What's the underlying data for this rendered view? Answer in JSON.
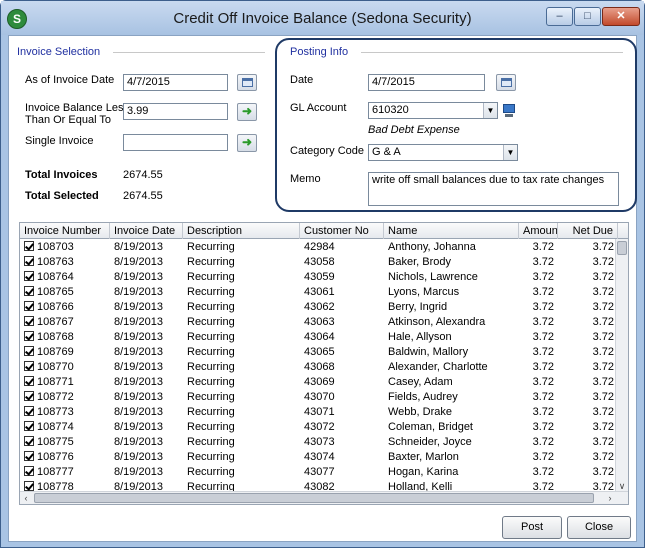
{
  "window": {
    "title": "Credit Off Invoice Balance (Sedona Security)",
    "icon_letter": "S"
  },
  "invoice_selection": {
    "section_title": "Invoice Selection",
    "as_of_label": "As of Invoice Date",
    "as_of_value": "4/7/2015",
    "balance_label_line1": "Invoice Balance Less",
    "balance_label_line2": "Than Or Equal To",
    "balance_value": "3.99",
    "single_invoice_label": "Single Invoice",
    "single_invoice_value": "",
    "total_invoices_label": "Total Invoices",
    "total_invoices_value": "2674.55",
    "total_selected_label": "Total Selected",
    "total_selected_value": "2674.55"
  },
  "posting_info": {
    "section_title": "Posting Info",
    "date_label": "Date",
    "date_value": "4/7/2015",
    "gl_label": "GL Account",
    "gl_value": "610320",
    "gl_description": "Bad Debt Expense",
    "category_label": "Category Code",
    "category_value": "G & A",
    "memo_label": "Memo",
    "memo_value": "write off small balances due to tax rate changes"
  },
  "grid": {
    "columns": [
      "Invoice Number",
      "Invoice Date",
      "Description",
      "Customer No",
      "Name",
      "Amount",
      "Net Due"
    ],
    "rows": [
      [
        "108703",
        "8/19/2013",
        "Recurring",
        "42984",
        "Anthony, Johanna",
        "3.72",
        "3.72"
      ],
      [
        "108763",
        "8/19/2013",
        "Recurring",
        "43058",
        "Baker, Brody",
        "3.72",
        "3.72"
      ],
      [
        "108764",
        "8/19/2013",
        "Recurring",
        "43059",
        "Nichols, Lawrence",
        "3.72",
        "3.72"
      ],
      [
        "108765",
        "8/19/2013",
        "Recurring",
        "43061",
        "Lyons, Marcus",
        "3.72",
        "3.72"
      ],
      [
        "108766",
        "8/19/2013",
        "Recurring",
        "43062",
        "Berry, Ingrid",
        "3.72",
        "3.72"
      ],
      [
        "108767",
        "8/19/2013",
        "Recurring",
        "43063",
        "Atkinson, Alexandra",
        "3.72",
        "3.72"
      ],
      [
        "108768",
        "8/19/2013",
        "Recurring",
        "43064",
        "Hale, Allyson",
        "3.72",
        "3.72"
      ],
      [
        "108769",
        "8/19/2013",
        "Recurring",
        "43065",
        "Baldwin, Mallory",
        "3.72",
        "3.72"
      ],
      [
        "108770",
        "8/19/2013",
        "Recurring",
        "43068",
        "Alexander, Charlotte",
        "3.72",
        "3.72"
      ],
      [
        "108771",
        "8/19/2013",
        "Recurring",
        "43069",
        "Casey, Adam",
        "3.72",
        "3.72"
      ],
      [
        "108772",
        "8/19/2013",
        "Recurring",
        "43070",
        "Fields, Audrey",
        "3.72",
        "3.72"
      ],
      [
        "108773",
        "8/19/2013",
        "Recurring",
        "43071",
        "Webb, Drake",
        "3.72",
        "3.72"
      ],
      [
        "108774",
        "8/19/2013",
        "Recurring",
        "43072",
        "Coleman, Bridget",
        "3.72",
        "3.72"
      ],
      [
        "108775",
        "8/19/2013",
        "Recurring",
        "43073",
        "Schneider, Joyce",
        "3.72",
        "3.72"
      ],
      [
        "108776",
        "8/19/2013",
        "Recurring",
        "43074",
        "Baxter, Marlon",
        "3.72",
        "3.72"
      ],
      [
        "108777",
        "8/19/2013",
        "Recurring",
        "43077",
        "Hogan, Karina",
        "3.72",
        "3.72"
      ],
      [
        "108778",
        "8/19/2013",
        "Recurring",
        "43082",
        "Holland, Kelli",
        "3.72",
        "3.72"
      ]
    ]
  },
  "buttons": {
    "post": "Post",
    "close": "Close"
  }
}
